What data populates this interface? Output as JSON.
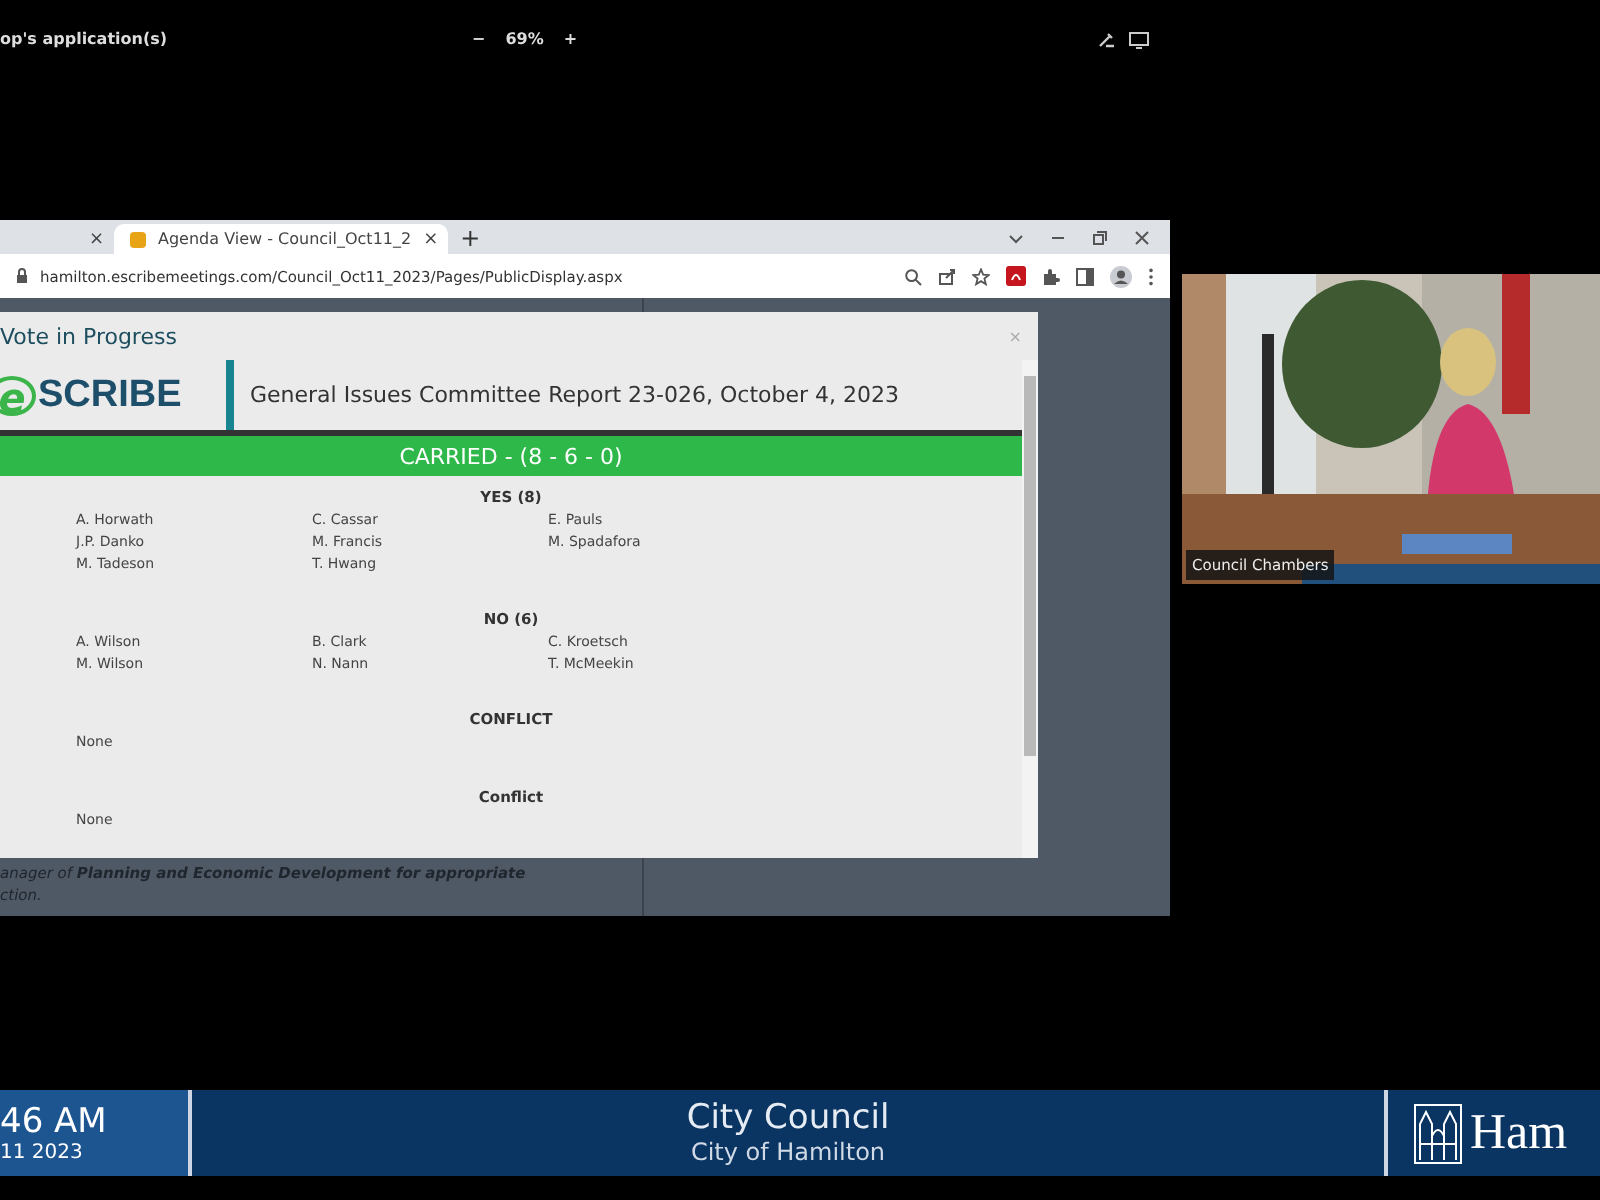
{
  "share_bar": {
    "title": "op's application(s)",
    "zoom_out": "−",
    "zoom": "69%",
    "zoom_in": "+"
  },
  "browser": {
    "tabs": [
      {
        "close": "×",
        "selected": false
      },
      {
        "label": "Agenda View - Council_Oct11_2",
        "close": "×",
        "selected": true
      }
    ],
    "new_tab": "+",
    "url": "hamilton.escribemeetings.com/Council_Oct11_2023/Pages/PublicDisplay.aspx"
  },
  "page": {
    "text_lines": [
      "anager of **Planning and Economic Development for appropriate**",
      "ction."
    ]
  },
  "dialog": {
    "title": "Vote in Progress",
    "close": "×",
    "logo_mark": "e",
    "logo_text": "SCRIBE",
    "item_title": "General Issues Committee Report 23-026, October 4, 2023",
    "result": "CARRIED - (8 - 6 - 0)",
    "sections": [
      {
        "heading": "YES (8)",
        "members": [
          "A. Horwath",
          "C. Cassar",
          "E. Pauls",
          "J.P. Danko",
          "M. Francis",
          "M. Spadafora",
          "M. Tadeson",
          "T. Hwang"
        ]
      },
      {
        "heading": "NO (6)",
        "members": [
          "A. Wilson",
          "B. Clark",
          "C. Kroetsch",
          "M. Wilson",
          "N. Nann",
          "T. McMeekin"
        ]
      },
      {
        "heading": "CONFLICT",
        "members": [
          "None"
        ]
      },
      {
        "heading": "Conflict",
        "members": [
          "None"
        ]
      }
    ]
  },
  "video": {
    "caption": "Council Chambers"
  },
  "banner": {
    "time": "46 AM",
    "date": "11 2023",
    "title": "City Council",
    "subtitle": "City of Hamilton",
    "logo_text": "Ham"
  }
}
